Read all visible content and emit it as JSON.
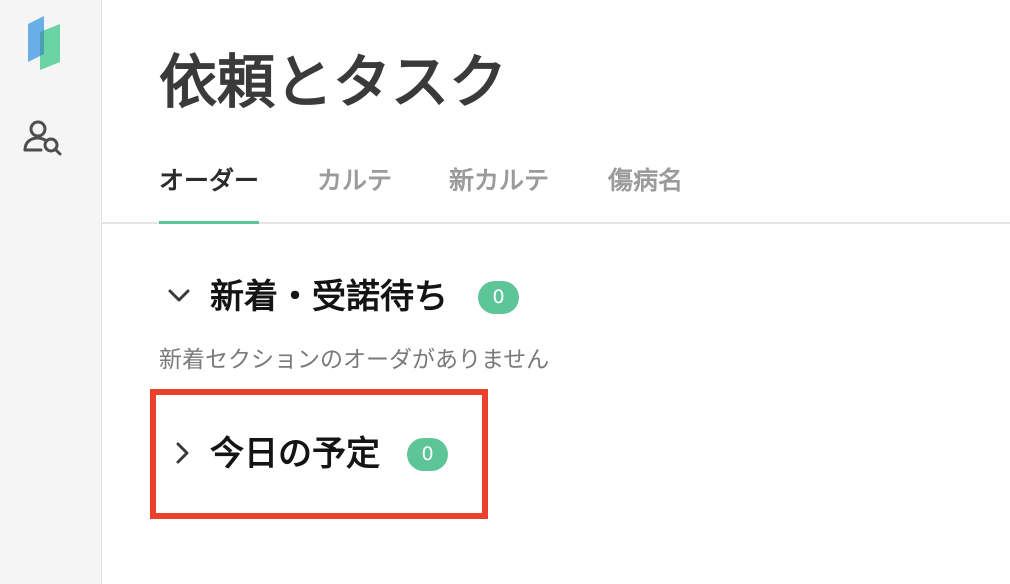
{
  "app": {
    "logo_icon": "app-logo-icon",
    "sidebar_icons": [
      "patient-search-icon"
    ]
  },
  "page": {
    "title": "依頼とタスク"
  },
  "tabs": [
    {
      "label": "オーダー",
      "active": true
    },
    {
      "label": "カルテ",
      "active": false
    },
    {
      "label": "新カルテ",
      "active": false
    },
    {
      "label": "傷病名",
      "active": false
    }
  ],
  "sections": {
    "new_pending": {
      "title": "新着・受諾待ち",
      "count": "0",
      "expanded": true,
      "empty_message": "新着セクションのオーダがありません"
    },
    "today": {
      "title": "今日の予定",
      "count": "0",
      "expanded": false
    }
  },
  "colors": {
    "accent": "#5ec598",
    "highlight": "#e9412c",
    "title_text": "#3a3a3a",
    "inactive_tab": "#9b9b9b"
  }
}
